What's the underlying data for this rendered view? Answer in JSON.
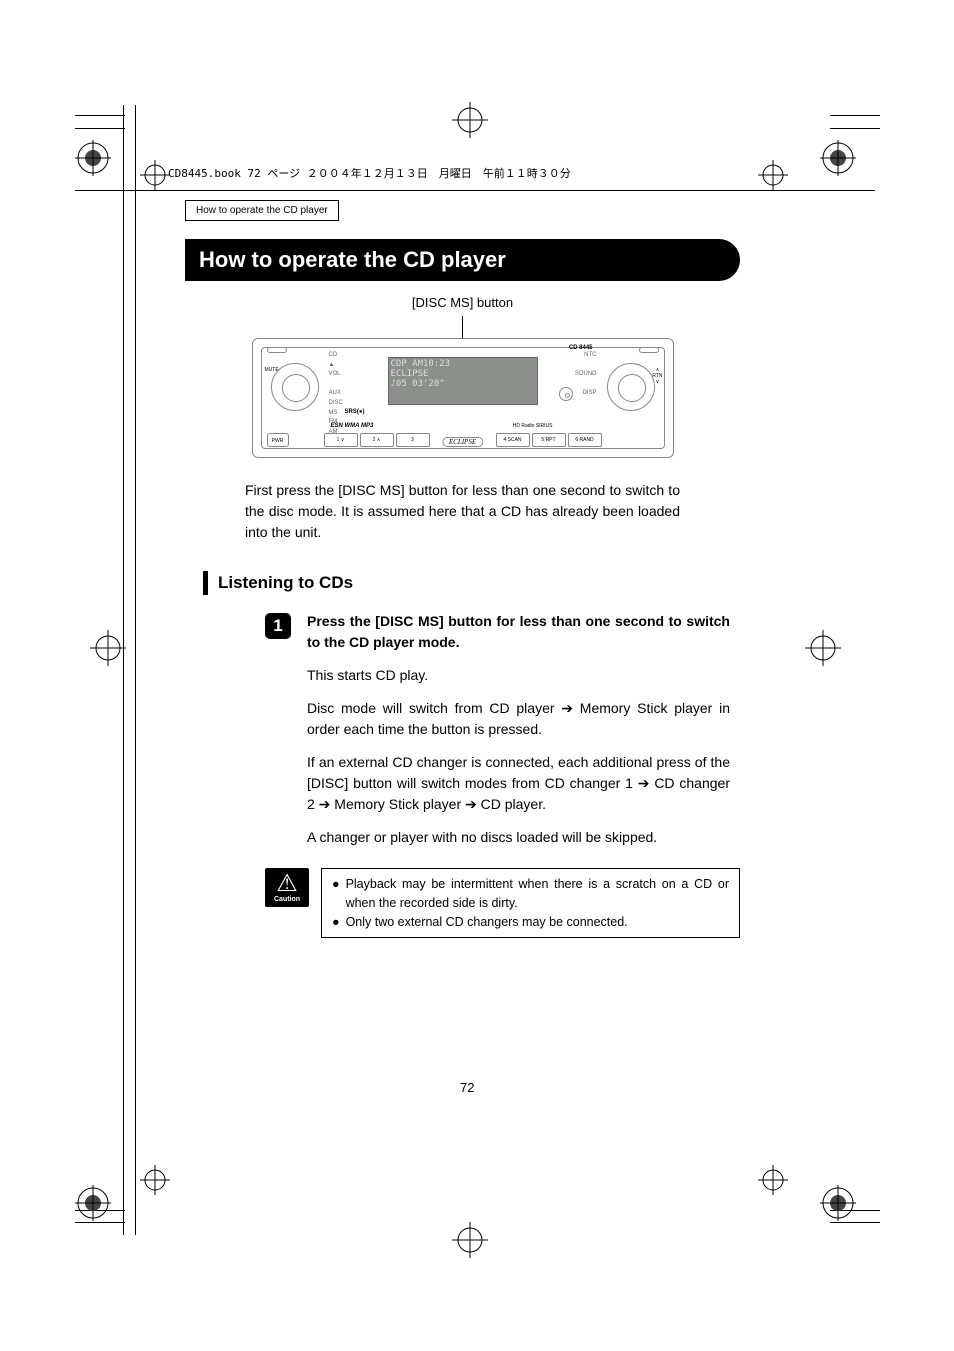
{
  "header_jp": "CD8445.book  72 ページ  ２００４年１２月１３日　月曜日　午前１１時３０分",
  "breadcrumb": "How to operate the CD player",
  "title": "How to operate the CD player",
  "callout": "[DISC MS] button",
  "device": {
    "model": "CD 8445",
    "lcd_line1": "CDP        AM10:23",
    "lcd_line2": "ECLIPSE",
    "lcd_line3": "♪05    03'20\"",
    "left_labels": "CD\n▲\nVOL\n\nAUX\nDISC\nMS\nFM\nAM",
    "esn": "ESN WMA MP3",
    "srs": "SRS(●)",
    "right_labels": "NTC\n\nSOUND\n\nDISP",
    "hd": "HD Radio  SIRIUS",
    "eclipse": "ECLIPSE",
    "pwr": "PWR",
    "mute": "MUTE",
    "side_r_up": "∧",
    "side_r_mid": "RTN",
    "side_r_dn": "∨",
    "btns": [
      "1 ∨",
      "2 ∧",
      "3",
      "",
      "4 SCAN",
      "5 RPT",
      "6 RAND"
    ]
  },
  "intro": "First press the [DISC MS] button for less than one second to switch to the disc mode. It is assumed here that a CD has already been loaded into the unit.",
  "section": "Listening to CDs",
  "step_num": "1",
  "step_title": "Press the [DISC MS] button for less than one second to switch to the CD player mode.",
  "step_p1": "This starts CD play.",
  "step_p2": "Disc mode will switch from CD player ➔   Memory Stick player in order each time the button is pressed.",
  "step_p3": "If an external CD changer is connected, each additional press of the [DISC] button will switch modes from CD changer 1 ➔ CD changer 2 ➔ Memory Stick player ➔ CD player.",
  "step_p4": "A changer or player with no discs loaded will be skipped.",
  "caution_label": "Caution",
  "caution1": "Playback may be intermittent when there is a scratch on a CD or when the recorded side is dirty.",
  "caution2": "Only two external CD changers may be connected.",
  "page_num": "72"
}
